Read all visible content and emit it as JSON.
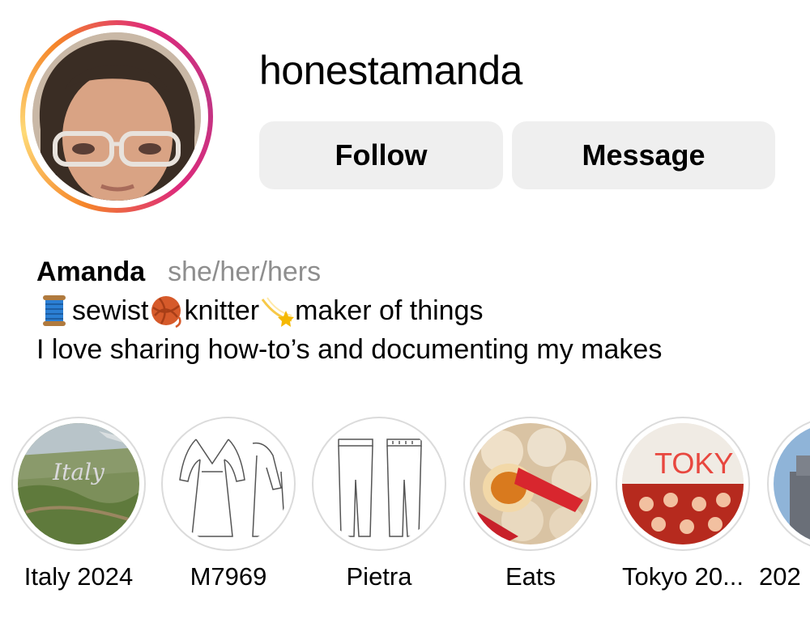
{
  "profile": {
    "username": "honestamanda",
    "follow_label": "Follow",
    "message_label": "Message",
    "name": "Amanda",
    "pronouns": "she/her/hers",
    "bio_line1": {
      "part1": "sewist",
      "part2": "knitter",
      "part3": "maker of things"
    },
    "bio_line2": "I love sharing how-to’s and documenting my makes"
  },
  "highlights": [
    {
      "label": "Italy 2024",
      "icon": "italy-landscape-photo"
    },
    {
      "label": "M7969",
      "icon": "dress-sketch"
    },
    {
      "label": "Pietra",
      "icon": "pants-sketch"
    },
    {
      "label": "Eats",
      "icon": "dumplings-photo"
    },
    {
      "label": "Tokyo 20...",
      "icon": "tokyo-book-photo"
    },
    {
      "label": "202",
      "icon": "tower-photo"
    }
  ],
  "colors": {
    "button_bg": "#efefef",
    "pronoun_gray": "#8e8e8e",
    "ring_border": "#dbdbdb"
  }
}
